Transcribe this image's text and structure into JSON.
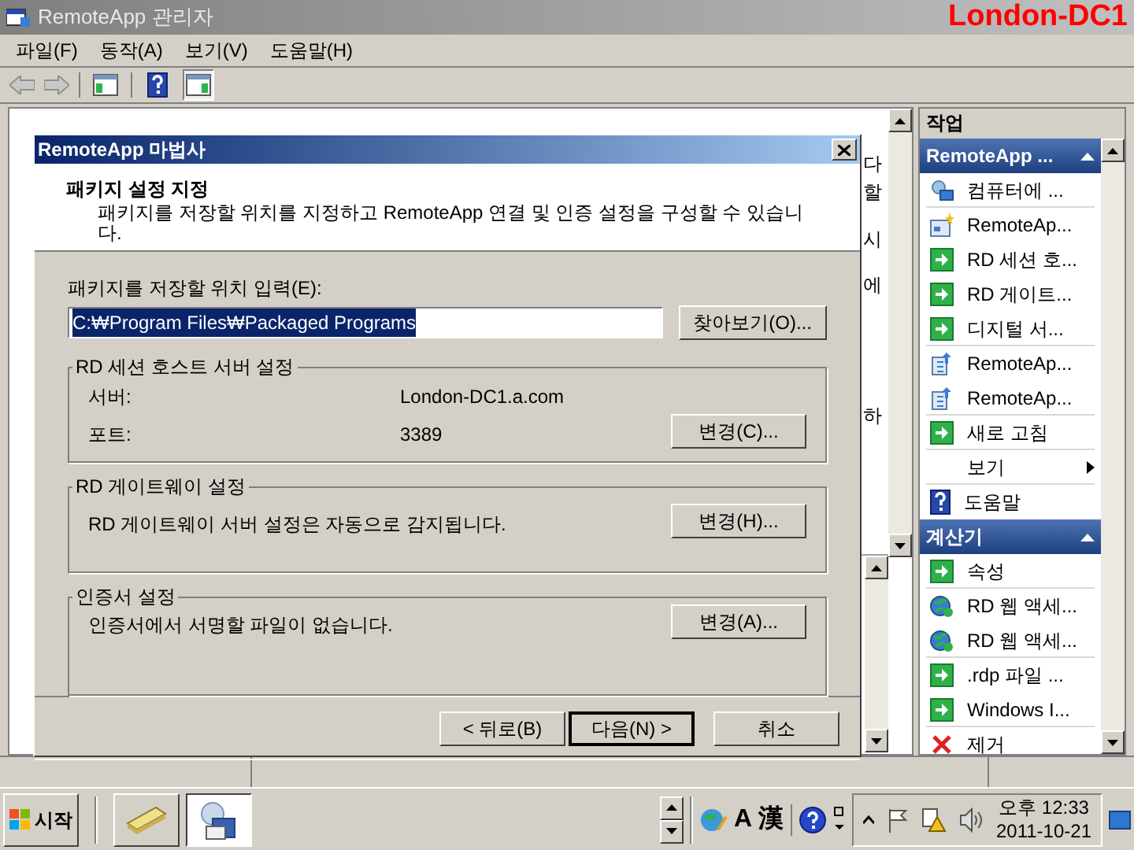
{
  "window": {
    "title": "RemoteApp 관리자",
    "overlay_label": "London-DC1"
  },
  "menu": [
    "파일(F)",
    "동작(A)",
    "보기(V)",
    "도움말(H)"
  ],
  "toolbar": [
    {
      "kind": "tree",
      "selected": false
    },
    {
      "kind": "help",
      "selected": false
    },
    {
      "kind": "actions",
      "selected": true
    }
  ],
  "background_fragments": [
    "다",
    "할",
    "시",
    "에",
    "하"
  ],
  "dialog": {
    "title": "RemoteApp 마법사",
    "heading": "패키지 설정 지정",
    "description": "패키지를 저장할 위치를 지정하고 RemoteApp 연결 및 인증 설정을 구성할 수 있습니 다.",
    "location_label": "패키지를 저장할 위치 입력(E):",
    "location_value": "C:₩Program Files₩Packaged Programs",
    "browse_button": "찾아보기(O)...",
    "groups": [
      {
        "title": "RD 세션 호스트 서버 설정",
        "rows": [
          {
            "label": "서버:",
            "value": "London-DC1.a.com"
          },
          {
            "label": "포트:",
            "value": "3389"
          }
        ],
        "button": "변경(C)..."
      },
      {
        "title": "RD 게이트웨이 설정",
        "text": "RD 게이트웨이 서버 설정은 자동으로 감지됩니다.",
        "button": "변경(H)..."
      },
      {
        "title": "인증서 설정",
        "text": "인증서에서 서명할 파일이 없습니다.",
        "button": "변경(A)..."
      }
    ],
    "buttons": [
      {
        "label": "< 뒤로(B)",
        "default": false
      },
      {
        "label": "다음(N) >",
        "default": true
      },
      {
        "label": "취소",
        "default": false
      }
    ]
  },
  "actions": {
    "title": "작업",
    "sections": [
      {
        "title": "RemoteApp ...",
        "expanded": true,
        "items": [
          {
            "label": "컴퓨터에 ...",
            "kind": "computer",
            "separator_after": true,
            "submenu": false
          },
          {
            "label": "RemoteAp...",
            "kind": "new",
            "separator_after": false,
            "submenu": false
          },
          {
            "label": "RD 세션 호...",
            "kind": "arrow",
            "separator_after": false,
            "submenu": false
          },
          {
            "label": "RD 게이트...",
            "kind": "arrow",
            "separator_after": false,
            "submenu": false
          },
          {
            "label": "디지털 서...",
            "kind": "arrow",
            "separator_after": true,
            "submenu": false
          },
          {
            "label": "RemoteAp...",
            "kind": "package",
            "separator_after": false,
            "submenu": false
          },
          {
            "label": "RemoteAp...",
            "kind": "package",
            "separator_after": true,
            "submenu": false
          },
          {
            "label": "새로 고침",
            "kind": "arrow",
            "separator_after": true,
            "submenu": false
          },
          {
            "label": "보기",
            "kind": "none",
            "separator_after": true,
            "submenu": true
          },
          {
            "label": "도움말",
            "kind": "help",
            "separator_after": false,
            "submenu": false
          }
        ]
      },
      {
        "title": "계산기",
        "expanded": true,
        "items": [
          {
            "label": "속성",
            "kind": "arrow",
            "separator_after": true,
            "submenu": false
          },
          {
            "label": "RD 웹 액세...",
            "kind": "globe",
            "separator_after": false,
            "submenu": false
          },
          {
            "label": "RD 웹 액세...",
            "kind": "globe",
            "separator_after": true,
            "submenu": false
          },
          {
            "label": ".rdp 파일 ...",
            "kind": "arrow",
            "separator_after": false,
            "submenu": false
          },
          {
            "label": "Windows I...",
            "kind": "arrow",
            "separator_after": true,
            "submenu": false
          },
          {
            "label": "제거",
            "kind": "remove",
            "submenu": false
          }
        ]
      }
    ]
  },
  "taskbar": {
    "start": "시작",
    "language": [
      "A",
      "漢"
    ],
    "clock_time": "오후 12:33",
    "clock_date": "2011-10-21"
  }
}
